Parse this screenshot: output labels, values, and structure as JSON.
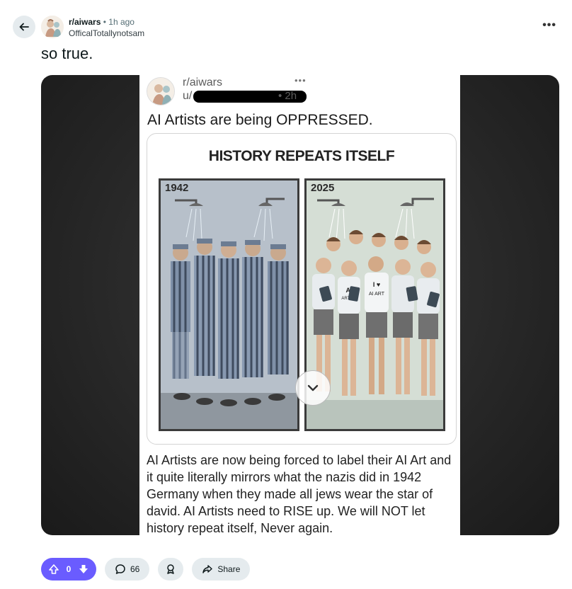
{
  "header": {
    "subreddit": "r/aiwars",
    "separator": "•",
    "time_ago": "1h ago",
    "author": "OfficalTotallynotsam",
    "back_icon": "arrow-left-icon",
    "overflow_label": "•••"
  },
  "post": {
    "title": "so true."
  },
  "embedded_screenshot": {
    "subreddit": "r/aiwars",
    "user_prefix": "u/",
    "time": "• 2h",
    "dots": "•••",
    "title": "AI Artists are being OPPRESSED.",
    "card_heading": "HISTORY REPEATS ITSELF",
    "left_panel_label": "1942",
    "right_panel_label": "2025",
    "shirt_texts": [
      "AI",
      "ARTIST",
      "I ♥",
      "AI ART"
    ],
    "body": "AI Artists are now being forced to label their AI Art and it quite literally mirrors what the nazis did in 1942 Germany when they made all jews wear the star of david. AI Artists need to RISE up. We will NOT let history repeat itself, Never again."
  },
  "actions": {
    "score": "0",
    "comments": "66",
    "share_label": "Share",
    "upvote_icon": "arrow-up-icon",
    "downvote_icon": "arrow-down-icon",
    "comment_icon": "comment-bubble-icon",
    "award_icon": "award-icon",
    "share_icon": "share-arrow-icon"
  },
  "colors": {
    "vote_accent": "#6a5cff",
    "pill_bg": "#e5ebee"
  }
}
